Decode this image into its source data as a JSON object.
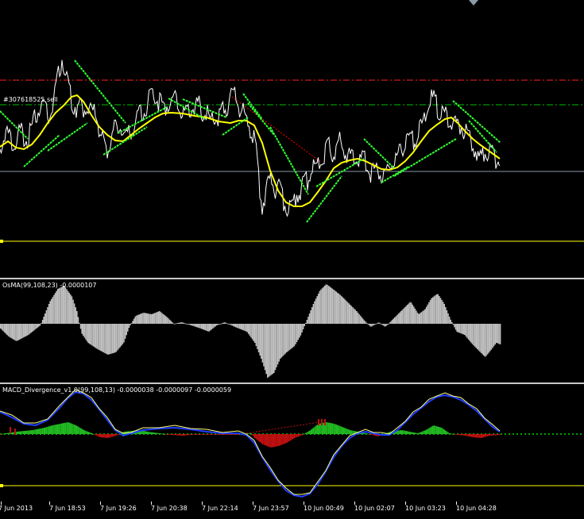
{
  "main_chart": {
    "order_label": "#307618525 sell",
    "colors": {
      "price": "#ffffff",
      "ma": "#ffff00",
      "trend_segments": "#33ff33",
      "sl_line": "#ff2020",
      "tp_line": "#00c000",
      "bid_line": "#8a9aa8",
      "order_arrow": "#ff0000",
      "level_line": "#ffff00"
    }
  },
  "osma_panel": {
    "label": "OsMA(99,108,23) -0.0000107",
    "color": "#bfbfbf"
  },
  "macd_panel": {
    "label": "MACD_Divergence_v1.0(99,108,13) -0.0000038 -0.0000097 -0.0000059",
    "colors": {
      "main_line": "#2040ff",
      "signal_line": "#ffff80",
      "hist_up": "#22bb22",
      "hist_down": "#c01010",
      "zero_line": "#00a000",
      "level_line": "#ffff00"
    }
  },
  "time_axis": {
    "labels": [
      "7 Jun 2013",
      "7 Jun 18:53",
      "7 Jun 19:26",
      "7 Jun 20:38",
      "7 Jun 22:14",
      "7 Jun 23:57",
      "10 Jun 00:49",
      "10 Jun 02:07",
      "10 Jun 03:23",
      "10 Jun 04:28"
    ]
  }
}
